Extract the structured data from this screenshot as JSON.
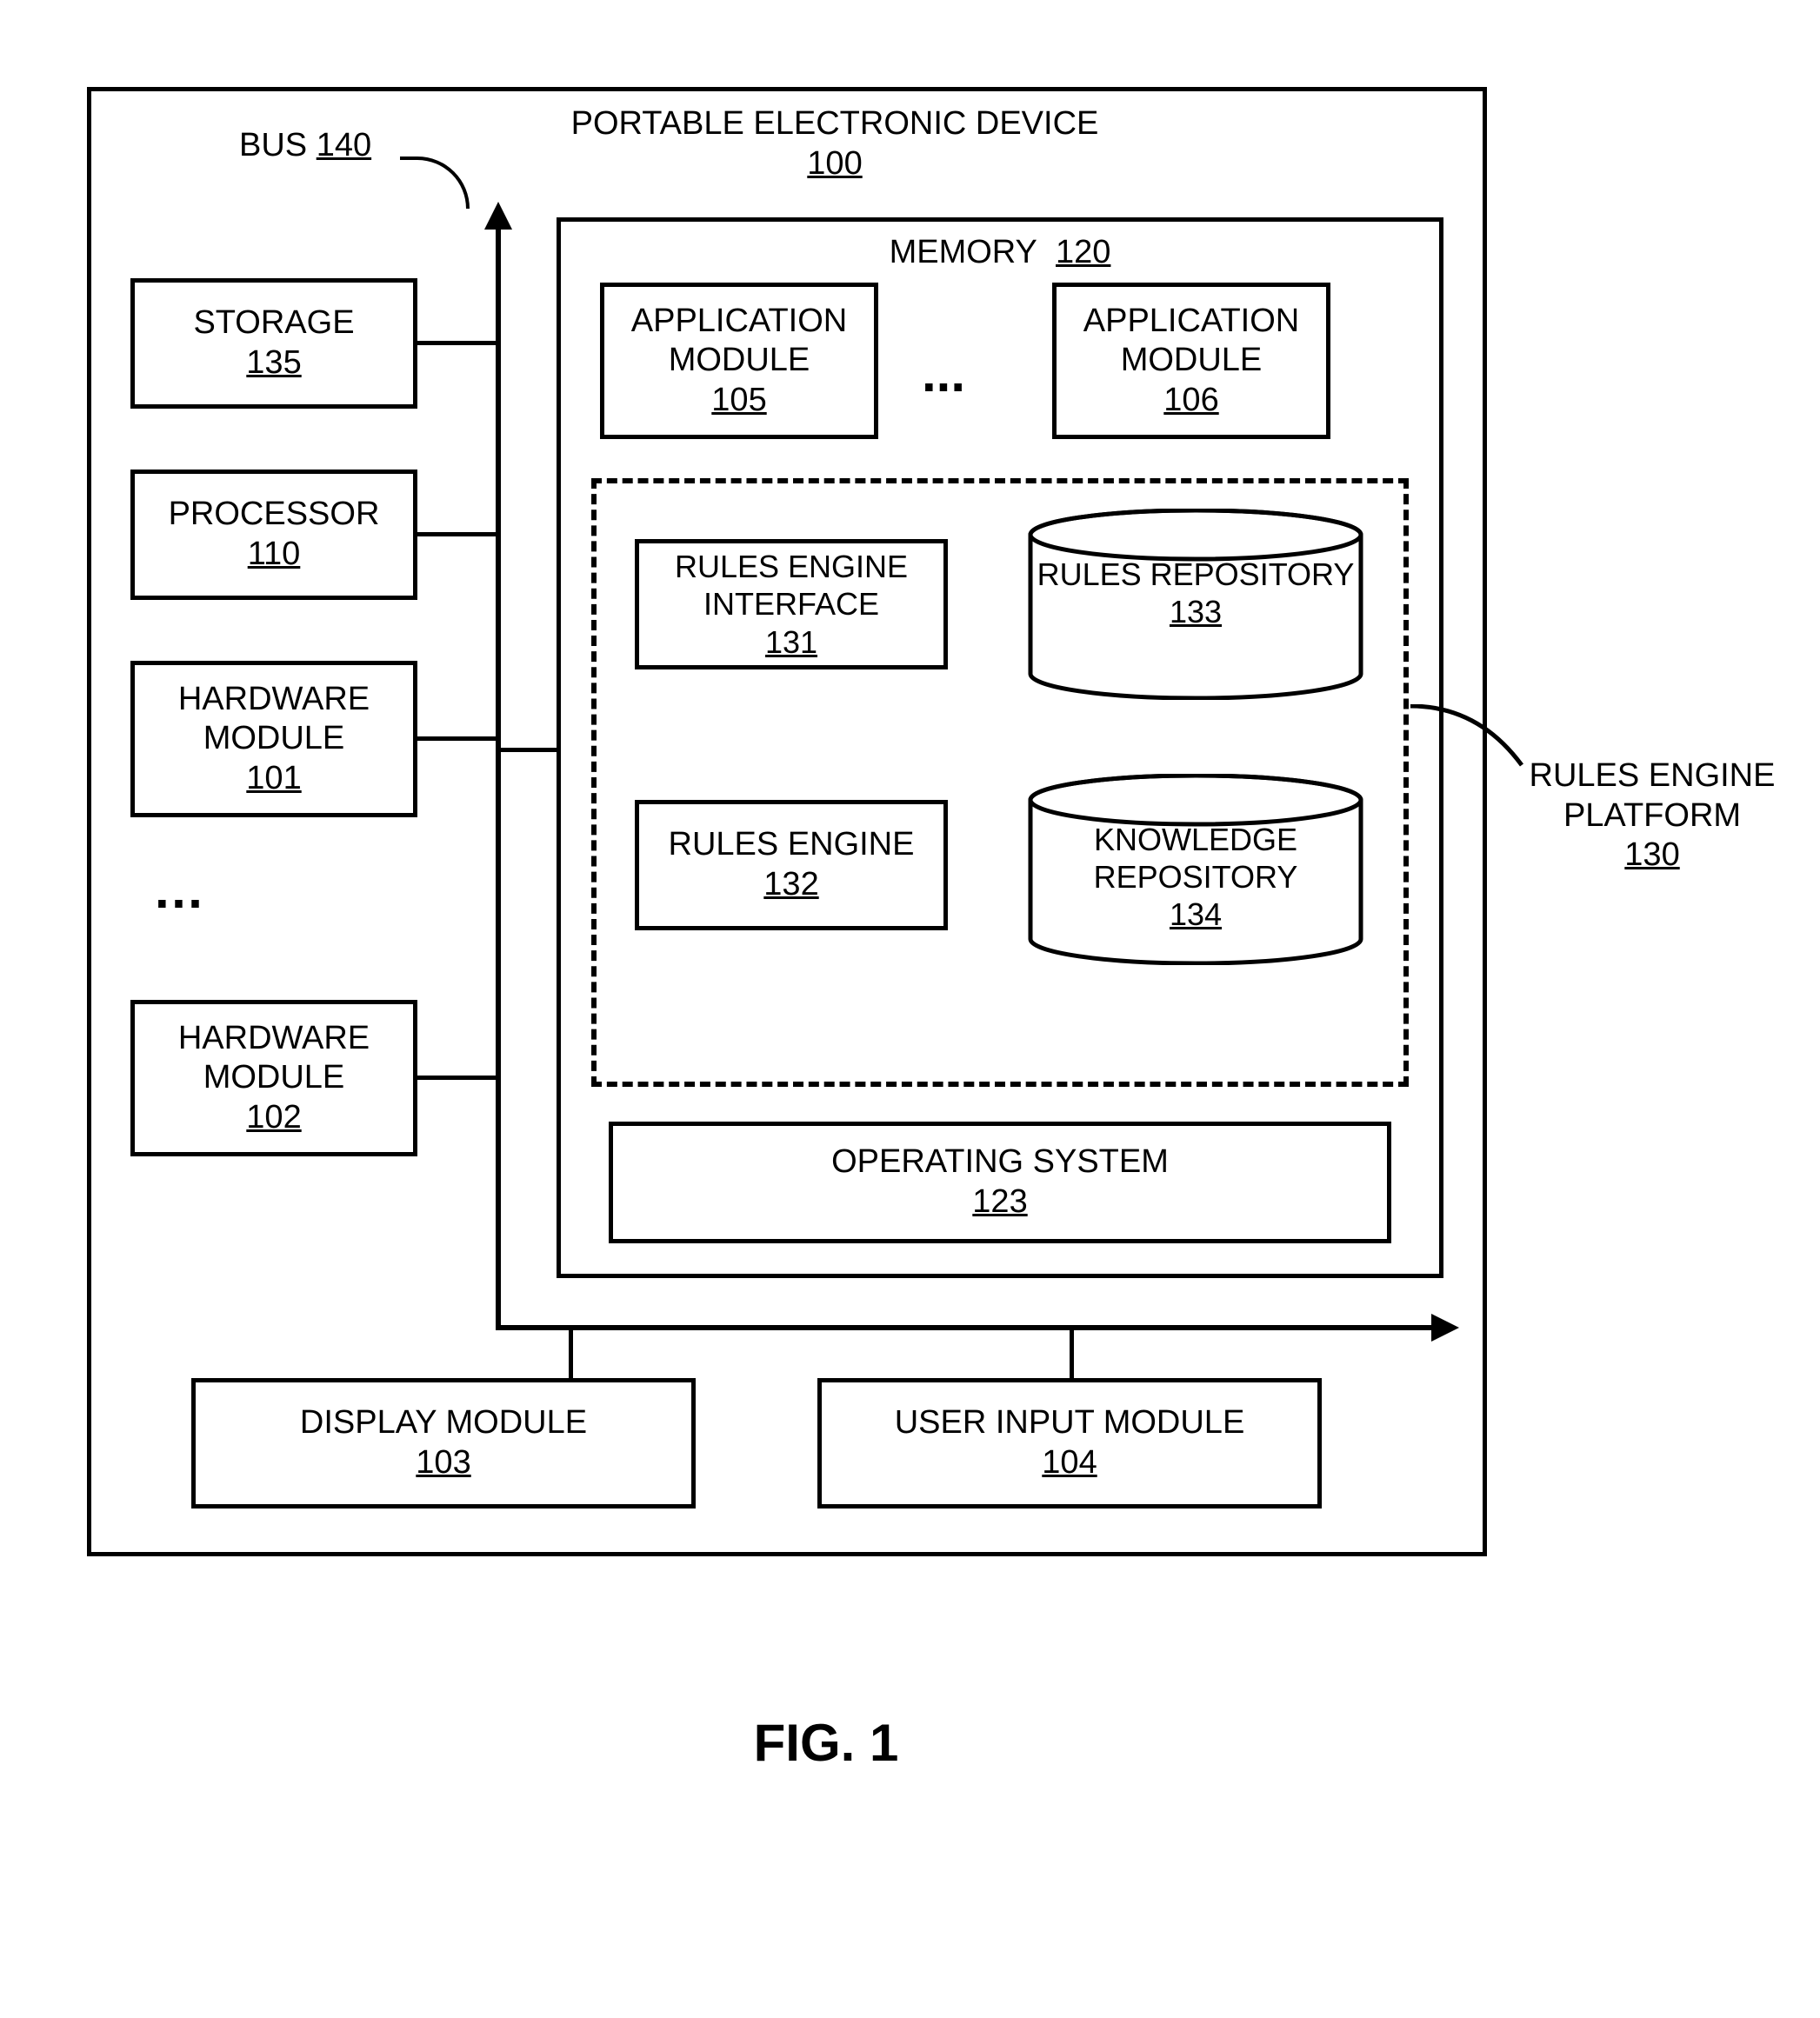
{
  "device": {
    "title": "PORTABLE ELECTRONIC DEVICE",
    "ref": "100"
  },
  "bus": {
    "label": "BUS",
    "ref": "140"
  },
  "left": {
    "storage": {
      "label": "STORAGE",
      "ref": "135"
    },
    "processor": {
      "label": "PROCESSOR",
      "ref": "110"
    },
    "hw1": {
      "label": "HARDWARE MODULE",
      "ref": "101"
    },
    "hw2": {
      "label": "HARDWARE MODULE",
      "ref": "102"
    }
  },
  "memory": {
    "label": "MEMORY",
    "ref": "120",
    "app1": {
      "label": "APPLICATION MODULE",
      "ref": "105"
    },
    "app2": {
      "label": "APPLICATION MODULE",
      "ref": "106"
    },
    "rei": {
      "label": "RULES ENGINE INTERFACE",
      "ref": "131"
    },
    "re": {
      "label": "RULES ENGINE",
      "ref": "132"
    },
    "rrepo": {
      "label": "RULES REPOSITORY",
      "ref": "133"
    },
    "krepo": {
      "label": "KNOWLEDGE REPOSITORY",
      "ref": "134"
    },
    "os": {
      "label": "OPERATING SYSTEM",
      "ref": "123"
    }
  },
  "platform": {
    "label": "RULES ENGINE PLATFORM",
    "ref": "130"
  },
  "bottom": {
    "display": {
      "label": "DISPLAY MODULE",
      "ref": "103"
    },
    "userinput": {
      "label": "USER INPUT MODULE",
      "ref": "104"
    }
  },
  "figure": "FIG. 1",
  "ellipsis": "…",
  "hellipsis": "..."
}
